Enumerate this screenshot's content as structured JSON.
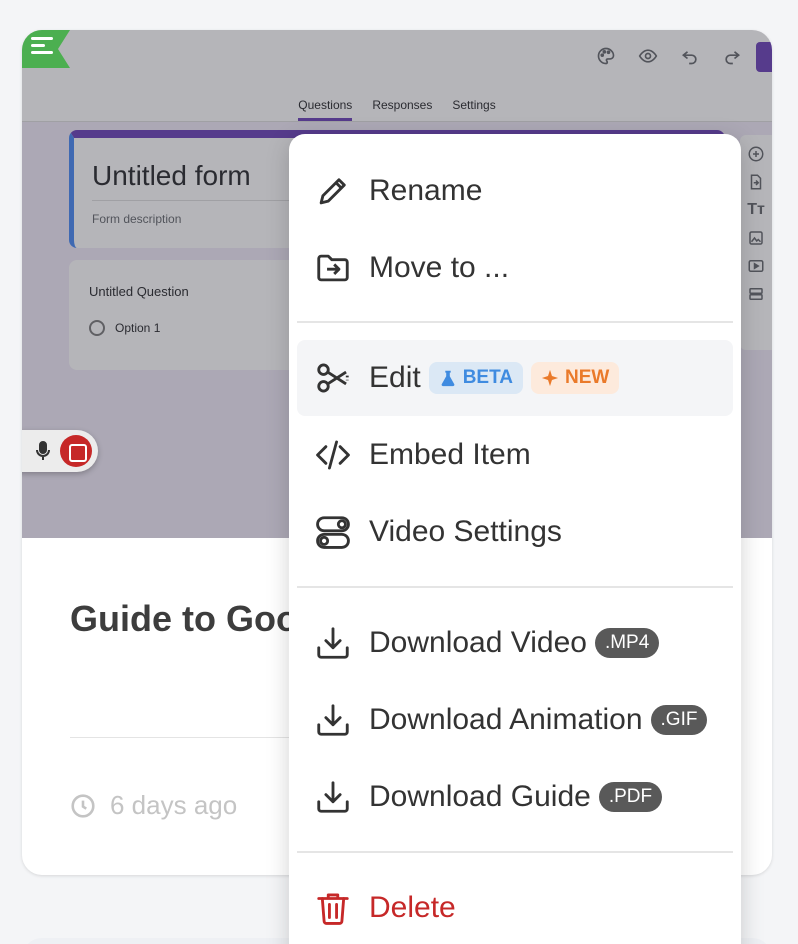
{
  "preview": {
    "tabs": [
      "Questions",
      "Responses",
      "Settings"
    ],
    "form_title": "Untitled form",
    "form_description": "Form description",
    "question_title": "Untitled Question",
    "option_label": "Option 1"
  },
  "card": {
    "title": "Guide to Goo",
    "time_ago": "6 days ago"
  },
  "menu": {
    "rename": "Rename",
    "move_to": "Move to ...",
    "edit": "Edit",
    "beta_badge": "BETA",
    "new_badge": "NEW",
    "embed": "Embed Item",
    "video_settings": "Video Settings",
    "download_video": "Download Video",
    "download_video_fmt": ".MP4",
    "download_animation": "Download Animation",
    "download_animation_fmt": ".GIF",
    "download_guide": "Download Guide",
    "download_guide_fmt": ".PDF",
    "delete": "Delete"
  },
  "colors": {
    "forms_purple": "#673ab7",
    "delete_red": "#c62828",
    "beta_blue": "#3f8be0",
    "new_orange": "#ea7a2a"
  }
}
